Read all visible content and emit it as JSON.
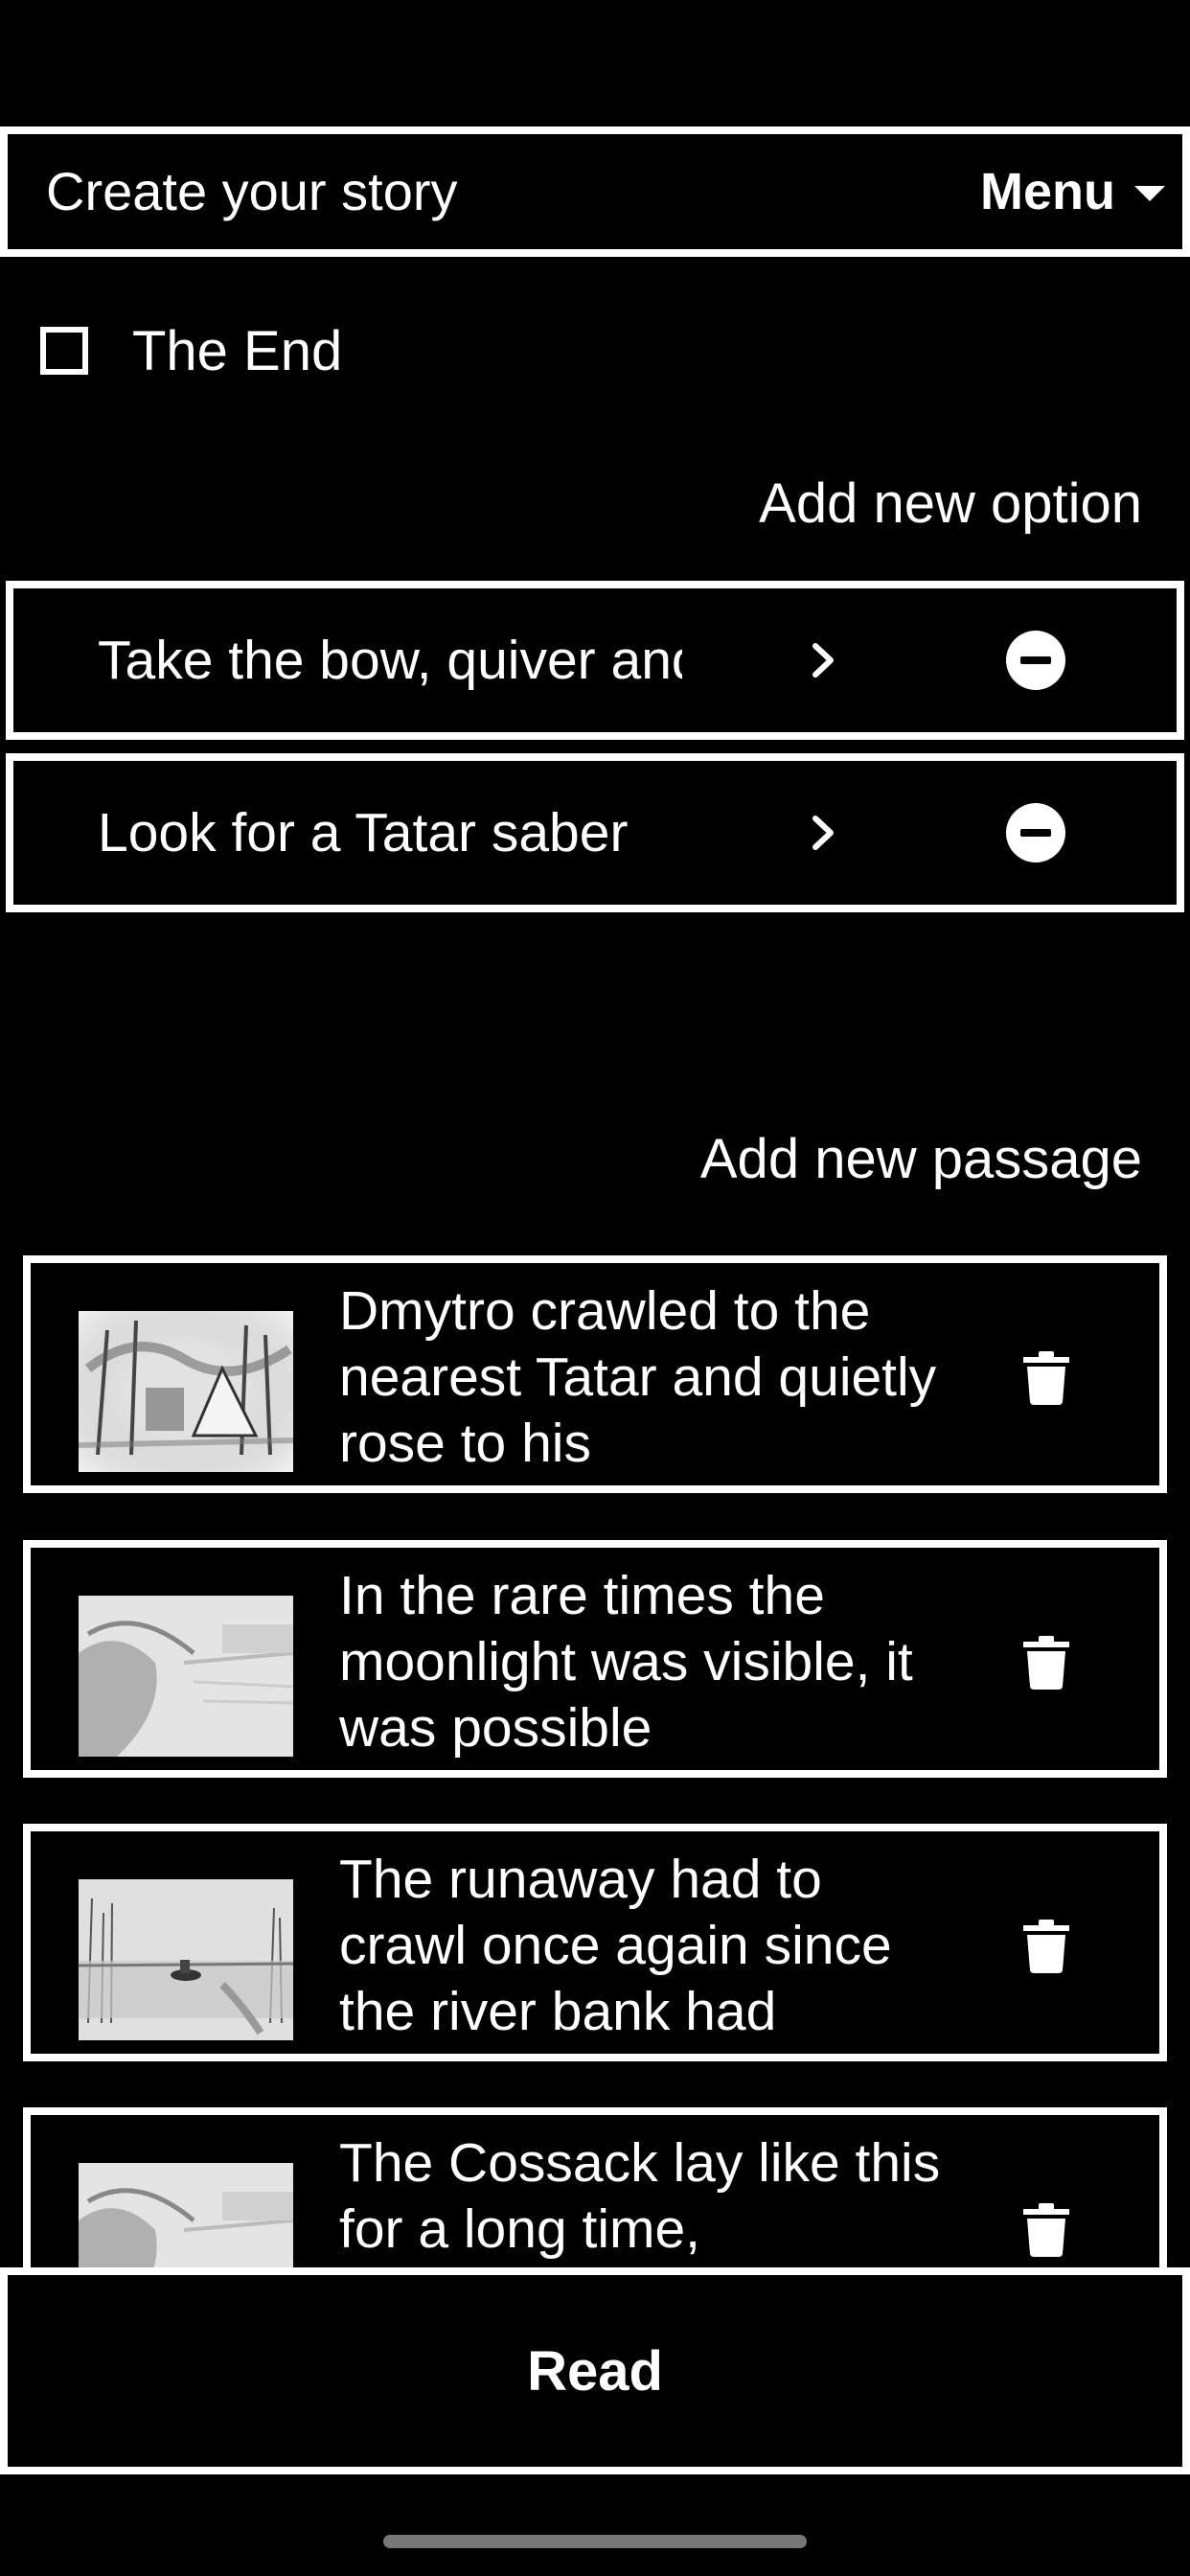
{
  "header": {
    "title": "Create your story",
    "menu_label": "Menu"
  },
  "end_toggle": {
    "label": "The End",
    "checked": false
  },
  "add_option_label": "Add new option",
  "options": [
    {
      "text": "Take the bow, quiver and arrows"
    },
    {
      "text": "Look for a Tatar saber"
    }
  ],
  "add_passage_label": "Add new passage",
  "passages": [
    {
      "text": "Dmytro crawled to the nearest Tatar and quietly rose to his"
    },
    {
      "text": "In the rare times the moonlight was visible, it was possible"
    },
    {
      "text": "The runaway had to crawl once again since the river bank had"
    },
    {
      "text": "The Cossack lay like this for a long time,"
    }
  ],
  "read_label": "Read",
  "icons": {
    "menu": "caret-down-icon",
    "option_open": "chevron-right-icon",
    "option_remove": "minus-circle-icon",
    "passage_delete": "trash-icon"
  }
}
